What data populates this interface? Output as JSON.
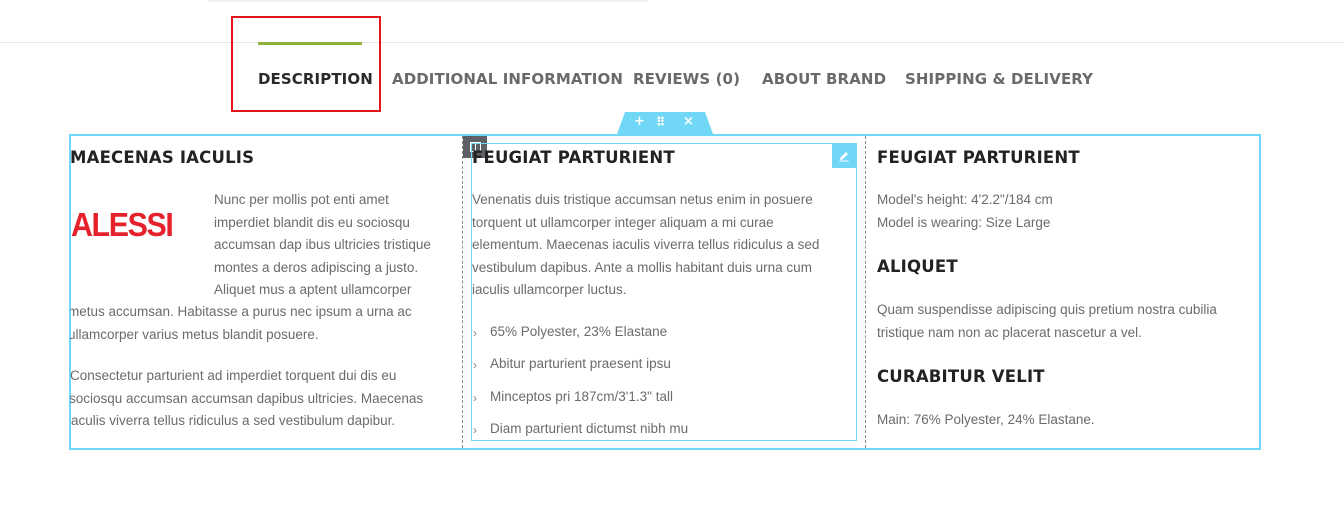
{
  "tabs": {
    "items": [
      {
        "label": "DESCRIPTION"
      },
      {
        "label": "ADDITIONAL INFORMATION"
      },
      {
        "label": "REVIEWS (0)"
      },
      {
        "label": "ABOUT BRAND"
      },
      {
        "label": "SHIPPING & DELIVERY"
      }
    ],
    "active_index": 0,
    "accent_color": "#8cb23b",
    "highlight_color": "#e0161b"
  },
  "editor": {
    "section_controls": {
      "add": "+",
      "drag": "⠿",
      "close": "×"
    },
    "accent_color": "#71d7f7"
  },
  "col1": {
    "title": "MAECENAS IACULIS",
    "logo_text": "ALESSI",
    "logo_color": "#e5222b",
    "para1_lines": [
      "Nunc per mollis pot enti amet",
      "imperdiet blandit dis eu sociosqu",
      "accumsan dap ibus ultricies tristique",
      "montes a deros adipiscing a justo.",
      "Aliquet mus a aptent ullamcorper",
      "metus accumsan. Habitasse a purus nec ipsum a urna ac",
      "ullamcorper varius metus blandit posuere."
    ],
    "para2_lines": [
      "Consectetur parturient ad imperdiet torquent dui dis eu",
      "sociosqu accumsan accumsan dapibus ultricies. Maecenas",
      "iaculis viverra tellus ridiculus a sed vestibulum dapibur."
    ]
  },
  "col2": {
    "title": "FEUGIAT PARTURIENT",
    "para_lines": [
      "Venenatis duis tristique accumsan netus enim in posuere",
      "torquent ut ullamcorper integer aliquam a mi curae",
      "elementum. Maecenas iaculis viverra tellus ridiculus a sed",
      "vestibulum dapibus. Ante a mollis habitant duis urna cum",
      "iaculis ullamcorper luctus."
    ],
    "list": [
      "65% Polyester, 23% Elastane",
      "Abitur parturient praesent ipsu",
      "Minceptos pri 187cm/3'1.3\" tall",
      "Diam parturient dictumst nibh mu"
    ]
  },
  "col3": {
    "title1": "FEUGIAT PARTURIENT",
    "line1": "Model's height: 4'2.2\"/184 cm",
    "line2": "Model is wearing: Size Large",
    "title2": "ALIQUET",
    "para2_lines": [
      "Quam suspendisse adipiscing quis pretium nostra cubilia",
      "tristique nam non ac placerat nascetur a vel."
    ],
    "title3": "CURABITUR VELIT",
    "line3": "Main: 76% Polyester, 24% Elastane."
  }
}
